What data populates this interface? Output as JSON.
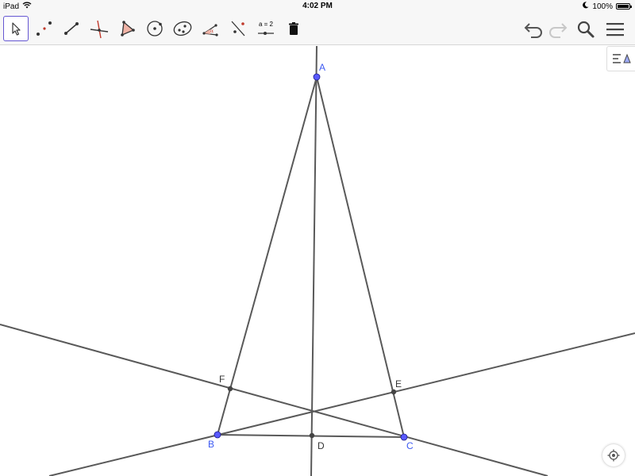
{
  "status_bar": {
    "device": "iPad",
    "time": "4:02 PM",
    "battery": "100%",
    "battery_level": 1.0
  },
  "toolbar": {
    "tools": [
      {
        "name": "move-tool",
        "icon": "arrow-cursor-icon",
        "selected": true
      },
      {
        "name": "point-tool",
        "icon": "points-icon",
        "selected": false
      },
      {
        "name": "segment-tool",
        "icon": "segment-icon",
        "selected": false
      },
      {
        "name": "perpendicular-line-tool",
        "icon": "perpendicular-icon",
        "selected": false
      },
      {
        "name": "polygon-tool",
        "icon": "polygon-icon",
        "selected": false
      },
      {
        "name": "circle-tool",
        "icon": "circle-center-point-icon",
        "selected": false
      },
      {
        "name": "ellipse-tool",
        "icon": "ellipse-icon",
        "selected": false
      },
      {
        "name": "angle-tool",
        "icon": "angle-icon",
        "selected": false
      },
      {
        "name": "reflect-tool",
        "icon": "reflect-about-line-icon",
        "selected": false
      },
      {
        "name": "slider-tool",
        "icon": "slider-icon",
        "label": "a = 2",
        "selected": false
      },
      {
        "name": "delete-tool",
        "icon": "trash-icon",
        "selected": false
      }
    ],
    "right": [
      "undo-icon",
      "redo-icon",
      "search-icon",
      "menu-icon"
    ]
  },
  "algebra_toggle": {
    "icon": "algebra-view-icon"
  },
  "construction": {
    "points": [
      {
        "name": "A",
        "free": true
      },
      {
        "name": "B",
        "free": true
      },
      {
        "name": "C",
        "free": true
      },
      {
        "name": "D",
        "free": false
      },
      {
        "name": "E",
        "free": false
      },
      {
        "name": "F",
        "free": false
      }
    ],
    "colors": {
      "free_point": "#5a5aff",
      "dependent_point": "#444444",
      "line": "#595959",
      "label_free": "#3d5af2",
      "label_dep": "#333333"
    }
  }
}
